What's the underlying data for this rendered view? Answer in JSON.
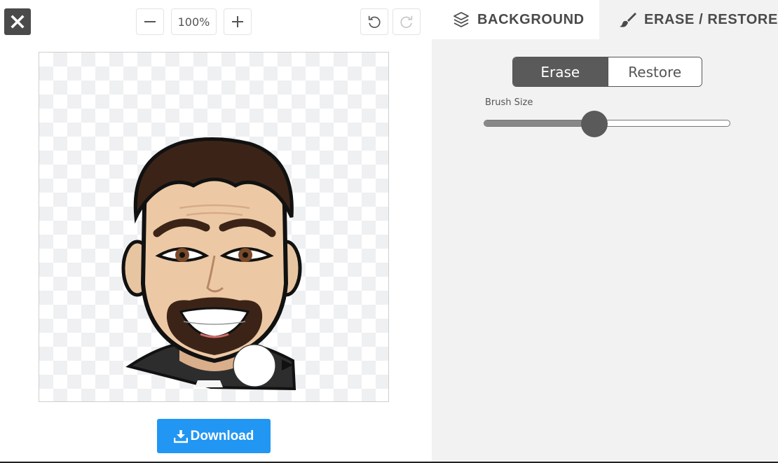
{
  "toolbar": {
    "zoom_level": "100%"
  },
  "editor": {
    "download_label": "Download"
  },
  "tabs": [
    {
      "label": "BACKGROUND",
      "icon": "layers-icon"
    },
    {
      "label": "ERASE / RESTORE",
      "icon": "brush-icon"
    }
  ],
  "mode": {
    "erase_label": "Erase",
    "restore_label": "Restore",
    "selected": "Erase"
  },
  "brush": {
    "label": "Brush Size",
    "value_fraction": 0.45
  },
  "colors": {
    "accent": "#2196f3",
    "dark": "#4a4a4a",
    "panel_bg": "#f2f2f2"
  }
}
